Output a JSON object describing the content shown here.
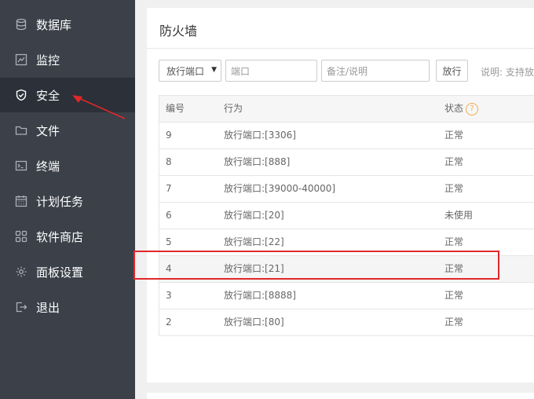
{
  "sidebar": {
    "items": [
      {
        "label": "数据库",
        "icon": "database-icon"
      },
      {
        "label": "监控",
        "icon": "monitor-icon"
      },
      {
        "label": "安全",
        "icon": "shield-icon",
        "active": true
      },
      {
        "label": "文件",
        "icon": "folder-icon"
      },
      {
        "label": "终端",
        "icon": "terminal-icon"
      },
      {
        "label": "计划任务",
        "icon": "calendar-icon"
      },
      {
        "label": "软件商店",
        "icon": "grid-icon"
      },
      {
        "label": "面板设置",
        "icon": "gear-icon"
      },
      {
        "label": "退出",
        "icon": "logout-icon"
      }
    ]
  },
  "main": {
    "title": "防火墙",
    "toolbar": {
      "select_value": "放行端口",
      "port_placeholder": "端口",
      "note_placeholder": "备注/说明",
      "allow_label": "放行",
      "hint": "说明: 支持放"
    },
    "table": {
      "headers": {
        "id": "编号",
        "action": "行为",
        "status": "状态",
        "help": "?"
      },
      "rows": [
        {
          "id": "9",
          "action": "放行端口:[3306]",
          "status": "正常"
        },
        {
          "id": "8",
          "action": "放行端口:[888]",
          "status": "正常"
        },
        {
          "id": "7",
          "action": "放行端口:[39000-40000]",
          "status": "正常"
        },
        {
          "id": "6",
          "action": "放行端口:[20]",
          "status": "未使用"
        },
        {
          "id": "5",
          "action": "放行端口:[22]",
          "status": "正常"
        },
        {
          "id": "4",
          "action": "放行端口:[21]",
          "status": "正常"
        },
        {
          "id": "3",
          "action": "放行端口:[8888]",
          "status": "正常"
        },
        {
          "id": "2",
          "action": "放行端口:[80]",
          "status": "正常"
        }
      ]
    }
  },
  "colors": {
    "sidebar_bg": "#3b4049",
    "sidebar_active_bg": "#2c3038",
    "annotation_red": "#e0282a",
    "help_orange": "#f0ad4e"
  }
}
